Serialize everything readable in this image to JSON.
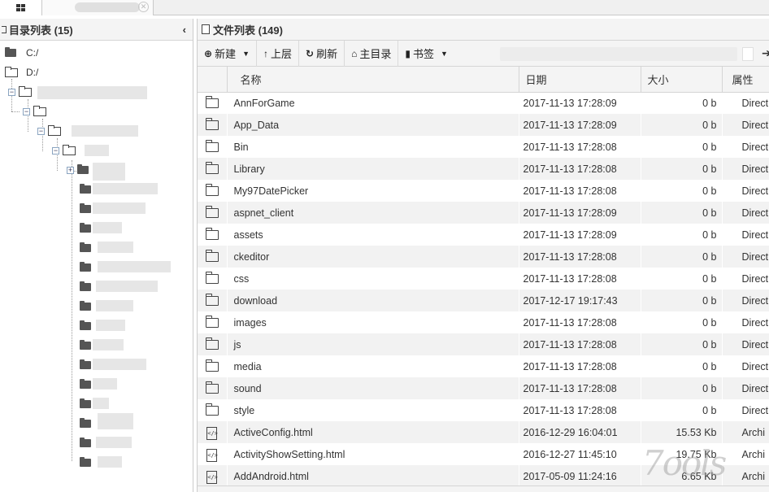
{
  "left_panel": {
    "title": "目录列表 (15)",
    "collapse_icon": "chevron-left-icon",
    "drives": [
      {
        "label": "C:/"
      },
      {
        "label": "D:/"
      }
    ]
  },
  "right_panel": {
    "title": "文件列表 (149)",
    "toolbar": {
      "new_label": "新建",
      "up_label": "上层",
      "refresh_label": "刷新",
      "home_label": "主目录",
      "bookmark_label": "书签"
    },
    "columns": {
      "name": "名称",
      "date": "日期",
      "size": "大小",
      "attr": "属性"
    },
    "rows": [
      {
        "type": "folder",
        "name": "AnnForGame",
        "date": "2017-11-13 17:28:09",
        "size": "0 b",
        "attr": "Direct"
      },
      {
        "type": "folder",
        "name": "App_Data",
        "date": "2017-11-13 17:28:09",
        "size": "0 b",
        "attr": "Direct"
      },
      {
        "type": "folder",
        "name": "Bin",
        "date": "2017-11-13 17:28:08",
        "size": "0 b",
        "attr": "Direct"
      },
      {
        "type": "folder",
        "name": "Library",
        "date": "2017-11-13 17:28:08",
        "size": "0 b",
        "attr": "Direct"
      },
      {
        "type": "folder",
        "name": "My97DatePicker",
        "date": "2017-11-13 17:28:08",
        "size": "0 b",
        "attr": "Direct"
      },
      {
        "type": "folder",
        "name": "aspnet_client",
        "date": "2017-11-13 17:28:09",
        "size": "0 b",
        "attr": "Direct"
      },
      {
        "type": "folder",
        "name": "assets",
        "date": "2017-11-13 17:28:09",
        "size": "0 b",
        "attr": "Direct"
      },
      {
        "type": "folder",
        "name": "ckeditor",
        "date": "2017-11-13 17:28:08",
        "size": "0 b",
        "attr": "Direct"
      },
      {
        "type": "folder",
        "name": "css",
        "date": "2017-11-13 17:28:08",
        "size": "0 b",
        "attr": "Direct"
      },
      {
        "type": "folder",
        "name": "download",
        "date": "2017-12-17 19:17:43",
        "size": "0 b",
        "attr": "Direct"
      },
      {
        "type": "folder",
        "name": "images",
        "date": "2017-11-13 17:28:08",
        "size": "0 b",
        "attr": "Direct"
      },
      {
        "type": "folder",
        "name": "js",
        "date": "2017-11-13 17:28:08",
        "size": "0 b",
        "attr": "Direct"
      },
      {
        "type": "folder",
        "name": "media",
        "date": "2017-11-13 17:28:08",
        "size": "0 b",
        "attr": "Direct"
      },
      {
        "type": "folder",
        "name": "sound",
        "date": "2017-11-13 17:28:08",
        "size": "0 b",
        "attr": "Direct"
      },
      {
        "type": "folder",
        "name": "style",
        "date": "2017-11-13 17:28:08",
        "size": "0 b",
        "attr": "Direct"
      },
      {
        "type": "file",
        "name": "ActiveConfig.html",
        "date": "2016-12-29 16:04:01",
        "size": "15.53 Kb",
        "attr": "Archi"
      },
      {
        "type": "file",
        "name": "ActivityShowSetting.html",
        "date": "2016-12-27 11:45:10",
        "size": "19.75 Kb",
        "attr": "Archi"
      },
      {
        "type": "file",
        "name": "AddAndroid.html",
        "date": "2017-05-09 11:24:16",
        "size": "6.65 Kb",
        "attr": "Archi"
      }
    ]
  }
}
